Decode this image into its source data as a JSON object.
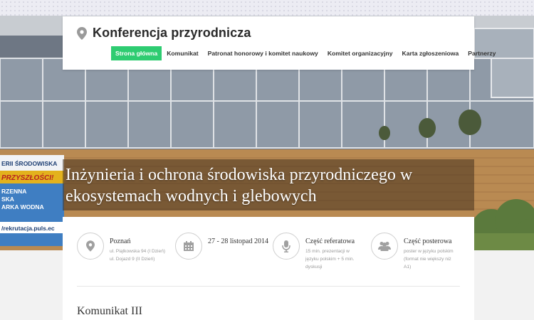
{
  "header": {
    "site_title": "Konferencja przyrodnicza",
    "nav": [
      {
        "label": "Strona główna",
        "active": true
      },
      {
        "label": "Komunikat"
      },
      {
        "label": "Patronat honorowy i komitet naukowy"
      },
      {
        "label": "Komitet organizacyjny"
      },
      {
        "label": "Karta zgłoszeniowa"
      },
      {
        "label": "Partnerzy"
      }
    ]
  },
  "hero": {
    "title_line1": "Inżynieria i ochrona środowiska przyrodniczego w",
    "title_line2": "ekosystemach wodnych i glebowych",
    "sign_text": [
      "ERII ŚRODOWISKA",
      "PRZYSZŁOŚCI!",
      "RZENNA",
      "SKA",
      "ARKA WODNA"
    ],
    "url_text": "/rekrutacja.puls.ec"
  },
  "info": [
    {
      "icon": "location-pin-icon",
      "title": "Poznań",
      "lines": [
        "ul. Piątkowska 94 (I Dzień)",
        "ul. Dojazd 9 (II Dzień)"
      ]
    },
    {
      "icon": "calendar-icon",
      "title": "27 - 28 listopad 2014",
      "lines": []
    },
    {
      "icon": "microphone-icon",
      "title": "Część referatowa",
      "lines": [
        "15 min. prezentacji w",
        "języku polskim + 5 min.",
        "dyskusji"
      ]
    },
    {
      "icon": "people-icon",
      "title": "Część posterowa",
      "lines": [
        "poster w języku polskim",
        "(format nie większy niż",
        "A1)"
      ]
    }
  ],
  "section": {
    "title": "Komunikat III"
  },
  "colors": {
    "accent": "#2ecc71",
    "banner": "#463220",
    "text": "#333333"
  }
}
